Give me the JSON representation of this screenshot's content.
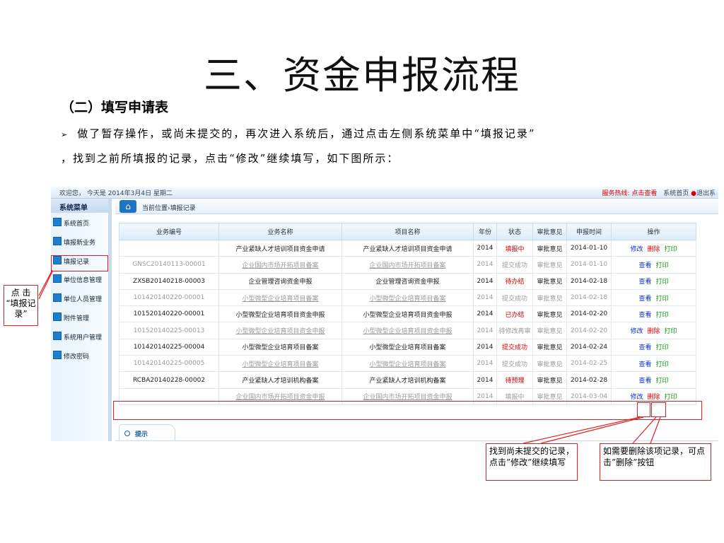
{
  "slide": {
    "title": "三、资金申报流程",
    "subtitle": "（二）填写申请表",
    "bullet": "➢",
    "para1": "做了暂存操作，或尚未提交的，再次进入系统后，通过点击左侧系统菜单中“填报记录”",
    "para2": "，找到之前所填报的记录，点击“修改”继续填写，如下图所示："
  },
  "app": {
    "topbar_left": "欢迎您， 今天是 2014年3月4日 星期二",
    "topbar_hotline": "服务热线: 点击查看",
    "topbar_home": "系统首页",
    "topbar_exit": "退出系",
    "menu_title": "系统菜单",
    "menu": [
      {
        "label": "系统首页"
      },
      {
        "label": "填报新业务"
      },
      {
        "label": "填报记录"
      },
      {
        "label": "单位信息管理"
      },
      {
        "label": "单位人员管理"
      },
      {
        "label": "附件管理"
      },
      {
        "label": "系统用户管理"
      },
      {
        "label": "修改密码"
      }
    ],
    "breadcrumb": "当前位置›填报记录",
    "columns": [
      "业务编号",
      "业务名称",
      "项目名称",
      "年份",
      "状态",
      "审批意见",
      "申报时间",
      "操作"
    ],
    "rows": [
      {
        "id": "",
        "name": "产业紧缺人才培训项目资金申请",
        "project": "产业紧缺人才培训项目资金申请",
        "year": "2014",
        "status": "填报中",
        "opinion": "审批意见",
        "date": "2014-01-10",
        "ops": [
          "修改",
          "删除",
          "打印"
        ]
      },
      {
        "id": "GNSC20140113-00001",
        "name": "企业国内市场开拓项目备案",
        "project": "企业国内市场开拓项目备案",
        "year": "2014",
        "status": "提交成功",
        "opinion": "审批意见",
        "date": "2014-01-10",
        "ops": [
          "查看",
          "打印"
        ]
      },
      {
        "id": "ZXSB20140218-00003",
        "name": "企业管理咨询资金申报",
        "project": "企业管理咨询资金申报",
        "year": "2014",
        "status": "待办结",
        "opinion": "审批意见",
        "date": "2014-02-18",
        "ops": [
          "查看",
          "打印"
        ]
      },
      {
        "id": "101420140220-00001",
        "name": "小型微型企业培育项目备案",
        "project": "小型微型企业培育项目备案",
        "year": "2014",
        "status": "提交成功",
        "opinion": "审批意见",
        "date": "2014-02-18",
        "ops": [
          "查看",
          "打印"
        ]
      },
      {
        "id": "101520140220-00001",
        "name": "小型微型企业培育项目资金申报",
        "project": "小型微型企业培育项目资金申报",
        "year": "2014",
        "status": "已办结",
        "opinion": "审批意见",
        "date": "2014-02-20",
        "ops": [
          "查看",
          "打印"
        ]
      },
      {
        "id": "101520140225-00013",
        "name": "小型微型企业培育项目资金申报",
        "project": "小型微型企业培育项目资金申报",
        "year": "2014",
        "status": "待修改再审",
        "opinion": "审批意见",
        "date": "2014-02-20",
        "ops": [
          "修改",
          "删除",
          "打印"
        ]
      },
      {
        "id": "101420140225-00004",
        "name": "小型微型企业培育项目备案",
        "project": "小型微型企业培育项目备案",
        "year": "2014",
        "status": "提交成功",
        "opinion": "审批意见",
        "date": "2014-02-24",
        "ops": [
          "查看",
          "打印"
        ]
      },
      {
        "id": "101420140225-00005",
        "name": "小型微型企业培育项目备案",
        "project": "小型微型企业培育项目备案",
        "year": "2014",
        "status": "提交成功",
        "opinion": "审批意见",
        "date": "2014-02-25",
        "ops": [
          "查看",
          "打印"
        ]
      },
      {
        "id": "RCBA20140228-00002",
        "name": "产业紧缺人才培训机构备案",
        "project": "产业紧缺人才培训机构备案",
        "year": "2014",
        "status": "待预理",
        "opinion": "审批意见",
        "date": "2014-02-28",
        "ops": [
          "查看",
          "打印"
        ]
      },
      {
        "id": "",
        "name": "企业国内市场开拓项目资金申报",
        "project": "企业国内市场开拓项目资金申报",
        "year": "2014",
        "status": "填报中",
        "opinion": "审批意见",
        "date": "2014-03-04",
        "ops": [
          "修改",
          "删除",
          "打印"
        ]
      }
    ],
    "hint_tab": "提示"
  },
  "annotations": {
    "left_note": "点 击 “填报记录”",
    "note_edit": "找到尚未提交的记录，点击”修改”继续填写",
    "note_delete": "如需要删除该项记录，可点击”删除”按钮"
  },
  "colors": {
    "accent": "#1e74c4",
    "annotation": "#e02020"
  }
}
